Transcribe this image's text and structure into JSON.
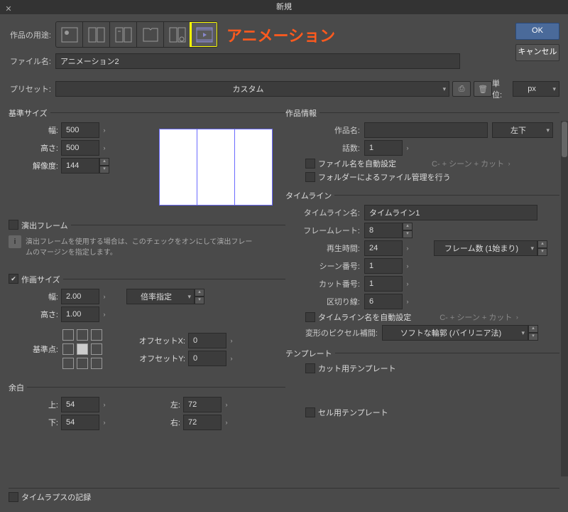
{
  "dialog": {
    "title": "新規",
    "ok": "OK",
    "cancel": "キャンセル"
  },
  "purpose": {
    "label": "作品の用途:",
    "annotation": "アニメーション"
  },
  "filename": {
    "label": "ファイル名:",
    "value": "アニメーション2"
  },
  "preset": {
    "label": "プリセット:",
    "value": "カスタム",
    "unit_label": "単位:",
    "unit": "px"
  },
  "base": {
    "title": "基準サイズ",
    "width_label": "幅:",
    "width": "500",
    "height_label": "高さ:",
    "height": "500",
    "res_label": "解像度:",
    "res": "144"
  },
  "direction_frame": {
    "label": "演出フレーム",
    "help": "演出フレームを使用する場合は、このチェックをオンにして演出フレームのマージンを指定します。"
  },
  "draw": {
    "title": "作画サイズ",
    "width_label": "幅:",
    "width": "2.00",
    "height_label": "高さ:",
    "height": "1.00",
    "mode_label": "倍率指定",
    "anchor_label": "基準点:",
    "offsetx_label": "オフセットX:",
    "offsetx": "0",
    "offsety_label": "オフセットY:",
    "offsety": "0"
  },
  "margin": {
    "title": "余白",
    "top_label": "上:",
    "top": "54",
    "bottom_label": "下:",
    "bottom": "54",
    "left_label": "左:",
    "left": "72",
    "right_label": "右:",
    "right": "72"
  },
  "timelapse": {
    "label": "タイムラプスの記録"
  },
  "info": {
    "title": "作品情報",
    "name_label": "作品名:",
    "name": "",
    "pos": "左下",
    "ep_label": "話数:",
    "ep": "1",
    "auto_filename": "ファイル名を自動設定",
    "auto_filename_hint": "C- + シーン + カット",
    "folder": "フォルダーによるファイル管理を行う"
  },
  "timeline": {
    "title": "タイムライン",
    "name_label": "タイムライン名:",
    "name": "タイムライン1",
    "fps_label": "フレームレート:",
    "fps": "8",
    "play_label": "再生時間:",
    "play": "24",
    "play_mode": "フレーム数 (1始まり)",
    "scene_label": "シーン番号:",
    "scene": "1",
    "cut_label": "カット番号:",
    "cut": "1",
    "div_label": "区切り線:",
    "div": "6",
    "auto_name": "タイムライン名を自動設定",
    "auto_name_hint": "C- + シーン + カット",
    "pixel_label": "変形のピクセル補間:",
    "pixel_value": "ソフトな輪郭 (バイリニア法)"
  },
  "template": {
    "title": "テンプレート",
    "cut": "カット用テンプレート",
    "cel": "セル用テンプレート"
  }
}
